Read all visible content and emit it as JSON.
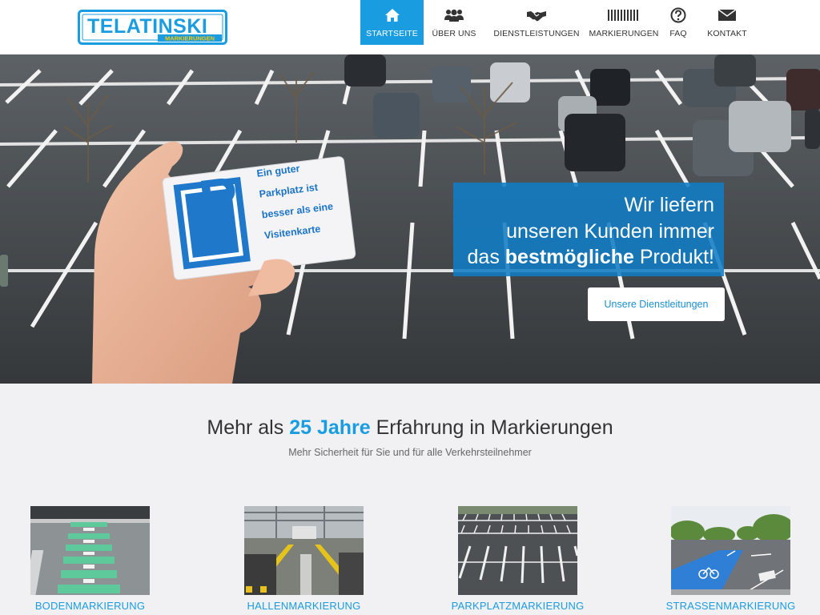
{
  "header": {
    "logo": {
      "main": "TELATINSKI",
      "sub": "MARKIERUNGEN"
    },
    "nav": [
      {
        "label": "STARTSEITE",
        "icon": "home-icon",
        "active": true
      },
      {
        "label": "ÜBER UNS",
        "icon": "users-icon",
        "active": false
      },
      {
        "label": "DIENSTLEISTUNGEN",
        "icon": "handshake-icon",
        "active": false
      },
      {
        "label": "MARKIERUNGEN",
        "icon": "barcode-icon",
        "active": false
      },
      {
        "label": "FAQ",
        "icon": "question-icon",
        "active": false
      },
      {
        "label": "KONTAKT",
        "icon": "envelope-icon",
        "active": false
      }
    ]
  },
  "hero": {
    "card_text": [
      "Ein guter",
      "Parkplatz ist",
      "besser als eine",
      "Visitenkarte"
    ],
    "card_sign": "P",
    "headline": {
      "line1": "Wir liefern",
      "line2": "unseren Kunden immer",
      "line3_pre": "das ",
      "line3_bold": "bestmögliche",
      "line3_post": " Produkt!"
    },
    "button": "Unsere Dienstleitungen"
  },
  "main": {
    "title_pre": "Mehr als ",
    "title_accent": "25 Jahre",
    "title_post": " Erfahrung in Markierungen",
    "subtitle": "Mehr Sicherheit für Sie und für alle Verkehrsteilnehmer",
    "services": [
      {
        "label": "BODENMARKIERUNG"
      },
      {
        "label": "HALLENMARKIERUNG"
      },
      {
        "label": "PARKPLATZMARKIERUNG"
      },
      {
        "label": "STRASSENMARKIERUNG"
      }
    ]
  },
  "colors": {
    "accent": "#1a9de0",
    "hero_box": "#117cc4",
    "logo_yellow": "#f7c600"
  }
}
